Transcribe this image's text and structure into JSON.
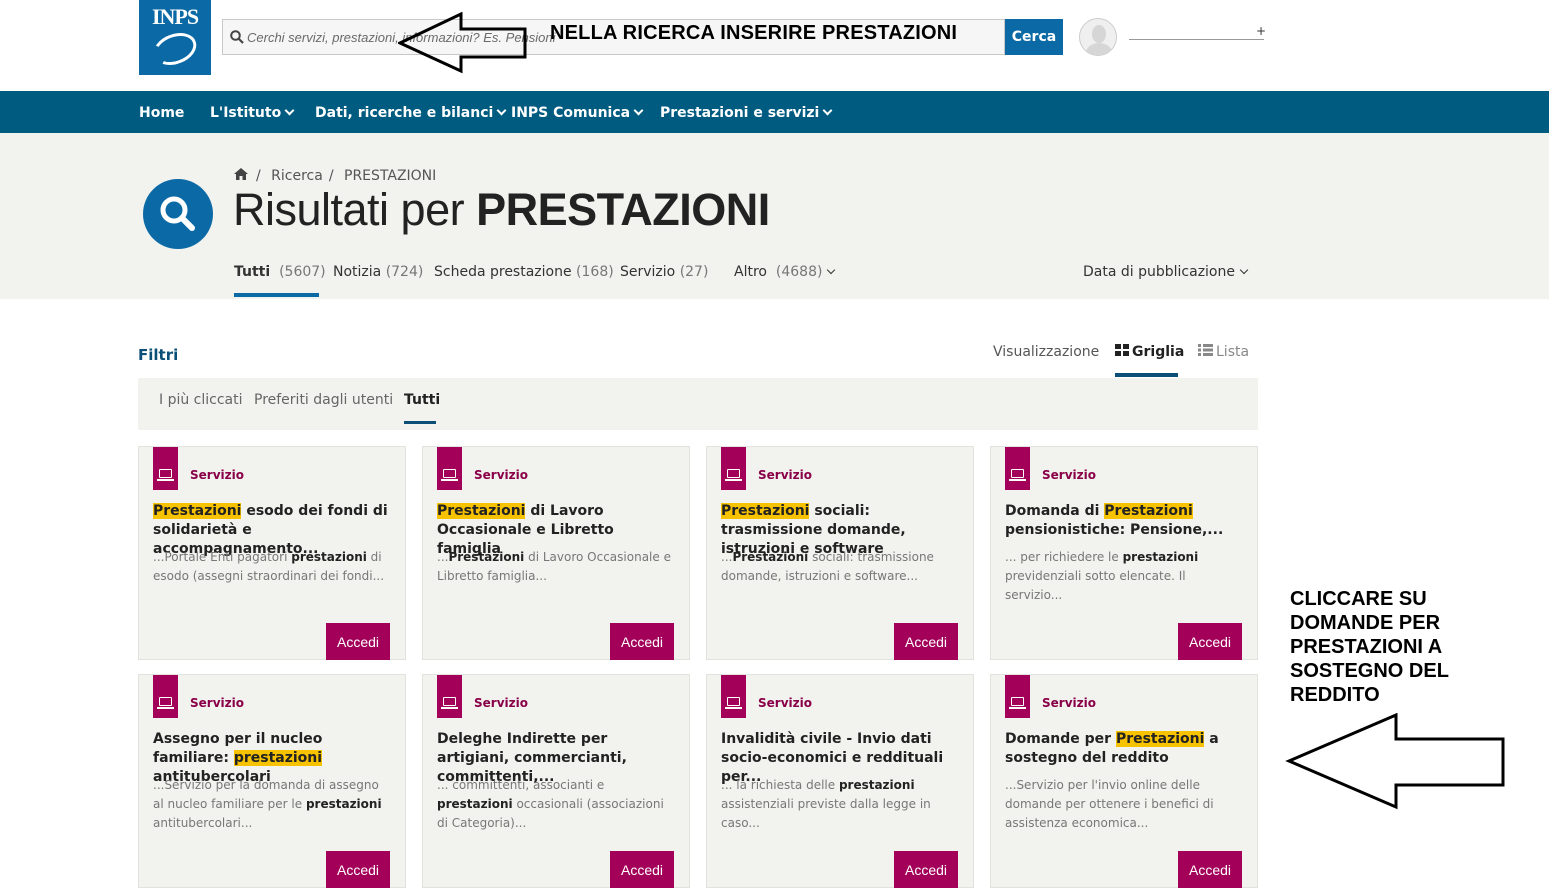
{
  "header": {
    "logo_text": "INPS",
    "search_placeholder": "Cerchi servizi, prestazioni, informazioni? Es. Pensioni",
    "search_button": "Cerca",
    "user_plus": "+"
  },
  "annotations": {
    "top": "NELLA RICERCA INSERIRE PRESTAZIONI",
    "right": "CLICCARE SU DOMANDE PER PRESTAZIONI A SOSTEGNO DEL REDDITO"
  },
  "nav": [
    {
      "label": "Home",
      "dropdown": false
    },
    {
      "label": "L'Istituto",
      "dropdown": true
    },
    {
      "label": "Dati, ricerche e bilanci",
      "dropdown": true
    },
    {
      "label": "INPS Comunica",
      "dropdown": true
    },
    {
      "label": "Prestazioni e servizi",
      "dropdown": true
    }
  ],
  "breadcrumb": {
    "sep": "/",
    "items": [
      "Ricerca",
      "PRESTAZIONI"
    ]
  },
  "page_title": {
    "prefix": "Risultati per ",
    "query": "PRESTAZIONI"
  },
  "result_tabs": [
    {
      "label": "Tutti",
      "count": "(5607)"
    },
    {
      "label": "Notizia",
      "count": "(724)"
    },
    {
      "label": "Scheda prestazione",
      "count": "(168)"
    },
    {
      "label": "Servizio",
      "count": "(27)"
    },
    {
      "label": "Altro",
      "count": "(4688)"
    }
  ],
  "sort_label": "Data di pubblicazione",
  "filters_label": "Filtri",
  "view": {
    "label": "Visualizzazione",
    "grid": "Griglia",
    "list": "Lista"
  },
  "filter_tabs": [
    "I più cliccati",
    "Preferiti dagli utenti",
    "Tutti"
  ],
  "cards": [
    {
      "kind": "Servizio",
      "title_hl": "Prestazioni",
      "title_rest": " esodo dei fondi di solidarietà e accompagnamento...",
      "title_pre": "",
      "desc_pre": "...Portale Enti pagatori ",
      "desc_b": "prestazioni",
      "desc_post": " di esodo (assegni straordinari dei fondi...",
      "button": "Accedi"
    },
    {
      "kind": "Servizio",
      "title_hl": "Prestazioni",
      "title_rest": " di Lavoro Occasionale e Libretto famiglia",
      "title_pre": "",
      "desc_pre": "...",
      "desc_b": "Prestazioni",
      "desc_post": " di Lavoro Occasionale e Libretto famiglia...",
      "button": "Accedi"
    },
    {
      "kind": "Servizio",
      "title_hl": "Prestazioni",
      "title_rest": " sociali: trasmissione domande, istruzioni e software",
      "title_pre": "",
      "desc_pre": "...",
      "desc_b": "Prestazioni",
      "desc_post": " sociali: trasmissione domande, istruzioni e software...",
      "button": "Accedi"
    },
    {
      "kind": "Servizio",
      "title_pre": "Domanda di ",
      "title_hl": "Prestazioni",
      "title_rest": " pensionistiche: Pensione,...",
      "desc_pre": "... per richiedere le ",
      "desc_b": "prestazioni",
      "desc_post": " previdenziali sotto elencate. Il servizio...",
      "button": "Accedi"
    },
    {
      "kind": "Servizio",
      "title_pre": "Assegno per il nucleo familiare: ",
      "title_hl": "prestazioni",
      "title_rest": " antitubercolari",
      "desc_pre": "...Servizio per la domanda di assegno al nucleo familiare per le ",
      "desc_b": "prestazioni",
      "desc_post": " antitubercolari...",
      "button": "Accedi"
    },
    {
      "kind": "Servizio",
      "title_pre": "Deleghe Indirette per artigiani, commercianti, committenti,...",
      "title_hl": "",
      "title_rest": "",
      "desc_pre": "... committenti, associanti e ",
      "desc_b": "prestazioni",
      "desc_post": " occasionali (associazioni di Categoria)...",
      "button": "Accedi"
    },
    {
      "kind": "Servizio",
      "title_pre": "Invalidità civile - Invio dati socio-economici e reddituali per...",
      "title_hl": "",
      "title_rest": "",
      "desc_pre": "... la richiesta delle ",
      "desc_b": "prestazioni",
      "desc_post": " assistenziali previste dalla legge in caso...",
      "button": "Accedi"
    },
    {
      "kind": "Servizio",
      "title_pre": "Domande per ",
      "title_hl": "Prestazioni",
      "title_rest": " a sostegno del reddito",
      "desc_pre": "...Servizio per l'invio online delle domande per ottenere i benefici di assistenza economica...",
      "desc_b": "",
      "desc_post": "",
      "button": "Accedi"
    }
  ],
  "colors": {
    "primary": "#0b6aa6",
    "nav": "#005b80",
    "accent": "#a3005a",
    "highlight": "#f7c200",
    "hero_bg": "#f2f2ee"
  }
}
